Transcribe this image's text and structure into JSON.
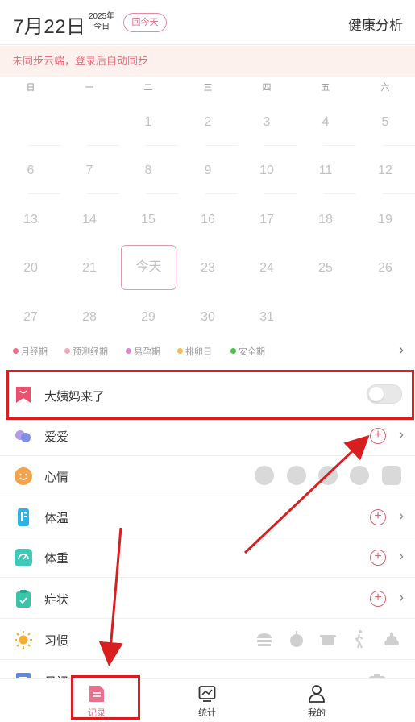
{
  "header": {
    "date": "7月22日",
    "year": "2025年",
    "today_sub": "今日",
    "back_today_label": "回今天",
    "analysis_label": "健康分析"
  },
  "banner": {
    "text": "未同步云端，登录后自动同步"
  },
  "calendar": {
    "weekdays": [
      "日",
      "一",
      "二",
      "三",
      "四",
      "五",
      "六"
    ],
    "days": [
      "1",
      "2",
      "3",
      "4",
      "5",
      "6",
      "7",
      "8",
      "9",
      "10",
      "11",
      "12",
      "13",
      "14",
      "15",
      "16",
      "17",
      "18",
      "19",
      "20",
      "21",
      "22",
      "23",
      "24",
      "25",
      "26",
      "27",
      "28",
      "29",
      "30",
      "31"
    ],
    "today_label": "今天"
  },
  "legend": {
    "items": [
      {
        "label": "月经期",
        "color": "#e8708a"
      },
      {
        "label": "预测经期",
        "color": "#f2a9bc"
      },
      {
        "label": "易孕期",
        "color": "#d58ad4"
      },
      {
        "label": "排卵日",
        "color": "#f0c060"
      },
      {
        "label": "安全期",
        "color": "#4cbf4c"
      }
    ]
  },
  "records": {
    "period": {
      "label": "大姨妈来了",
      "toggle_on": false
    },
    "love": {
      "label": "爱爱"
    },
    "mood": {
      "label": "心情"
    },
    "temperature": {
      "label": "体温"
    },
    "weight": {
      "label": "体重"
    },
    "symptoms": {
      "label": "症状"
    },
    "habits": {
      "label": "习惯"
    },
    "diary": {
      "label": "日记"
    }
  },
  "nav": {
    "record": {
      "label": "记录",
      "color": "#e8708a"
    },
    "stats": {
      "label": "统计"
    },
    "mine": {
      "label": "我的"
    }
  },
  "colors": {
    "accent": "#e8708a",
    "annotation": "#d81e1e"
  }
}
